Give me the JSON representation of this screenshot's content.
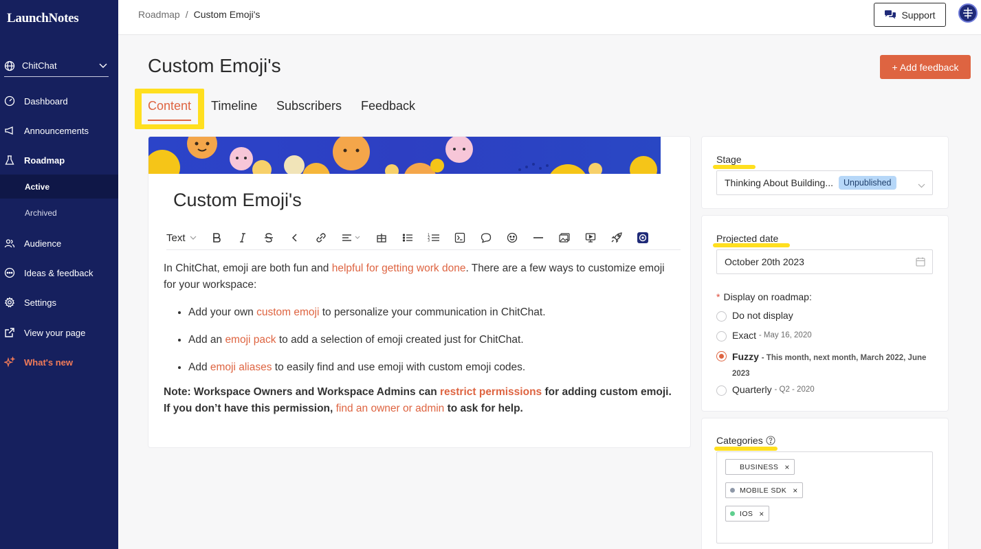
{
  "app": {
    "logo": "LaunchNotes"
  },
  "sidebar": {
    "workspace": "ChitChat",
    "items": {
      "dashboard": "Dashboard",
      "announcements": "Announcements",
      "roadmap": "Roadmap",
      "active": "Active",
      "archived": "Archived",
      "audience": "Audience",
      "ideas": "Ideas & feedback",
      "settings": "Settings",
      "view_page": "View your page",
      "whats_new": "What's new"
    }
  },
  "topbar": {
    "breadcrumb_root": "Roadmap",
    "breadcrumb_sep": "/",
    "breadcrumb_current": "Custom Emoji's",
    "support": "Support"
  },
  "page": {
    "title": "Custom Emoji's",
    "add_feedback": "+ Add feedback",
    "tabs": {
      "content": "Content",
      "timeline": "Timeline",
      "subscribers": "Subscribers",
      "feedback": "Feedback"
    }
  },
  "editor": {
    "title": "Custom Emoji's",
    "text_style": "Text",
    "intro_1": "In ChitChat, emoji are both fun and ",
    "intro_link": "helpful for getting work done",
    "intro_2": ". There are a few ways to customize emoji for your workspace:",
    "b1_pre": "Add your own ",
    "b1_link": "custom emoji",
    "b1_post": " to personalize your communication in ChitChat.",
    "b2_pre": "Add an ",
    "b2_link": "emoji pack",
    "b2_post": " to add a selection of emoji created just for ChitChat.",
    "b3_pre": "Add ",
    "b3_link": "emoji aliases",
    "b3_post": " to easily find and use emoji with custom emoji codes.",
    "note_1": "Note: Workspace Owners and Workspace Admins can ",
    "note_link1": "restrict permissions",
    "note_2": " for adding custom emoji. If you don’t have this permission, ",
    "note_link2": "find an owner or admin",
    "note_3": " to ask for help."
  },
  "stage": {
    "label": "Stage",
    "value": "Thinking About Building...",
    "badge": "Unpublished"
  },
  "projected": {
    "label": "Projected date",
    "value": "October 20th 2023",
    "display_label": "Display on roadmap:",
    "required_mark": "*",
    "options": {
      "none": "Do not display",
      "exact": "Exact",
      "exact_sub": "- May 16, 2020",
      "fuzzy": "Fuzzy",
      "fuzzy_sub": "- This month, next month, March 2022, June 2023",
      "quarterly": "Quarterly",
      "quarterly_sub": "- Q2 - 2020"
    },
    "selected": "fuzzy"
  },
  "categories": {
    "label": "Categories",
    "chips": [
      {
        "name": "BUSINESS",
        "color": "#ffffff"
      },
      {
        "name": "MOBILE SDK",
        "color": "#8e98a8"
      },
      {
        "name": "IOS",
        "color": "#5fcf8f"
      }
    ],
    "remove": "×"
  },
  "colors": {
    "sidebar": "#16205e",
    "accent": "#de6441",
    "highlight": "#ffdf1f"
  }
}
